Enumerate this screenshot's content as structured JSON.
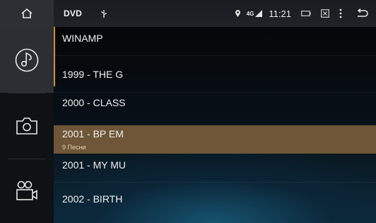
{
  "status_bar": {
    "source_label": "DVD",
    "time": "11:21",
    "signal_label": "4G",
    "icons": [
      "home-icon",
      "usb-icon",
      "location-icon",
      "signal-icon",
      "battery-icon",
      "screenshot-icon",
      "menu-icon",
      "back-icon"
    ]
  },
  "sidebar": {
    "tabs": [
      {
        "name": "music",
        "icon": "music-note-icon",
        "active": true
      },
      {
        "name": "photo",
        "icon": "camera-icon",
        "active": false
      },
      {
        "name": "video",
        "icon": "video-camera-icon",
        "active": false
      }
    ]
  },
  "list": {
    "items": [
      {
        "title": "WINAMP",
        "subtitle": ""
      },
      {
        "title": "1999 - THE G",
        "subtitle": ""
      },
      {
        "title": "2000 - CLASS",
        "subtitle": ""
      },
      {
        "title": "2001 - BP EM",
        "subtitle": "9 Песни",
        "selected": true
      },
      {
        "title": "2001 - MY MU",
        "subtitle": ""
      },
      {
        "title": "2002 - BIRTH",
        "subtitle": ""
      }
    ]
  },
  "colors": {
    "accent": "#d98a2c",
    "selected_row": "#6f5638",
    "sidebar_active": "#2b2e33"
  }
}
